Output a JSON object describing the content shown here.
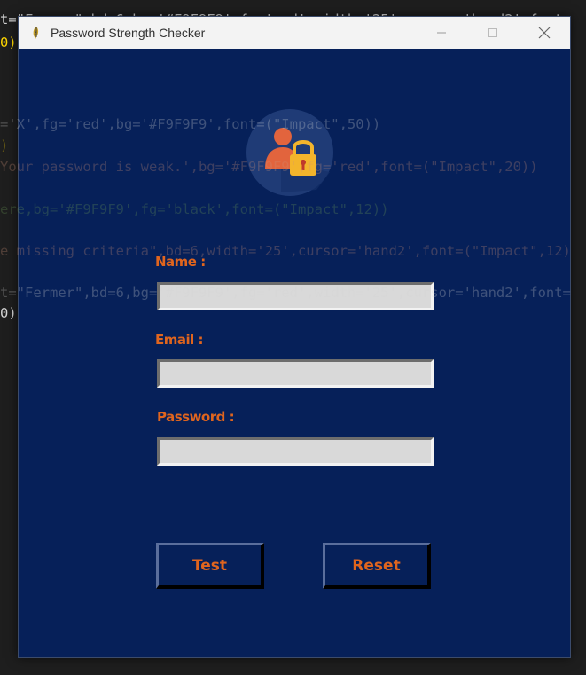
{
  "window": {
    "title": "Password Strength Checker",
    "minimize_symbol": "—",
    "maximize_symbol": "☐",
    "close_symbol": "✕"
  },
  "form": {
    "name_label": "Name :",
    "email_label": "Email :",
    "password_label": "Password :",
    "name_value": "",
    "email_value": "",
    "password_value": "",
    "test_button": "Test",
    "reset_button": "Reset"
  },
  "background_code": {
    "line1": "t=\"Fermer\",bd=6,bg='#F9F9F9',fg='red',width='25',cursor='hand2',font=",
    "line2": "0)",
    "line3": "='X',fg='red',bg='#F9F9F9',font=(\"Impact\",50))",
    "line4": ")",
    "line5": "Your password is weak.',bg='#F9F9F9',fg='red',font=(\"Impact\",20))",
    "line6": "ere,bg='#F9F9F9',fg='black',font=(\"Impact\",12))",
    "line7": "e missing criteria\",bd=6,width='25',cursor='hand2',font=(\"Impact\",12)",
    "line8": "t=\"Fermer\",bd=6,bg='#F9F9F9',fg='red',width='25',cursor='hand2',font=",
    "line9": "0)"
  },
  "colors": {
    "window_bg": "#062059",
    "accent": "#e0651e",
    "field_bg": "#d9d9d9"
  },
  "icons": {
    "app": "python-feather-icon",
    "logo": "user-lock-icon"
  }
}
